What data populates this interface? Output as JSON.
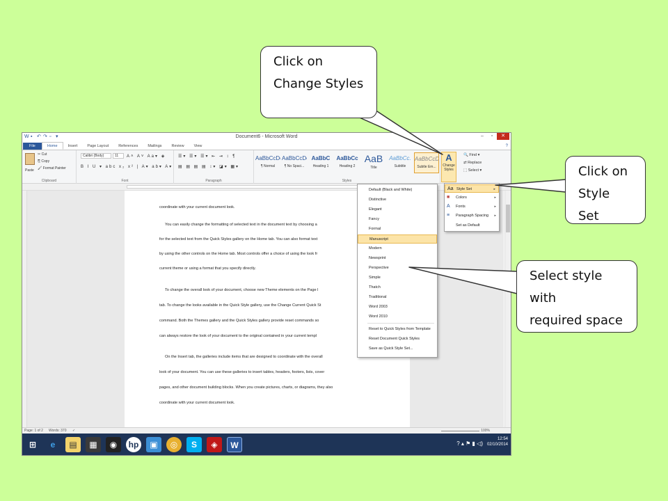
{
  "callouts": {
    "change_styles": [
      "Click on",
      "Change Styles"
    ],
    "style_set": [
      "Click on",
      "Style Set"
    ],
    "select_style": [
      "Select style with",
      "required space"
    ]
  },
  "window": {
    "title": "Document6 - Microsoft Word"
  },
  "tabs": [
    "File",
    "Home",
    "Insert",
    "Page Layout",
    "References",
    "Mailings",
    "Review",
    "View"
  ],
  "clipboard": {
    "paste": "Paste",
    "cut": "Cut",
    "copy": "Copy",
    "format_painter": "Format Painter",
    "group": "Clipboard"
  },
  "font": {
    "name": "Calibri (Body)",
    "size": "11",
    "group": "Font"
  },
  "paragraph": {
    "group": "Paragraph"
  },
  "styles": {
    "items": [
      {
        "preview": "AaBbCcDc",
        "name": "¶ Normal"
      },
      {
        "preview": "AaBbCcDc",
        "name": "¶ No Spaci..."
      },
      {
        "preview": "AaBbC",
        "name": "Heading 1"
      },
      {
        "preview": "AaBbCc",
        "name": "Heading 2"
      },
      {
        "preview": "AaB",
        "name": "Title"
      },
      {
        "preview": "AaBbCc.",
        "name": "Subtitle"
      },
      {
        "preview": "AaBbCcDc",
        "name": "Subtle Em..."
      }
    ],
    "group": "Styles",
    "change_styles": "Change Styles"
  },
  "editing": {
    "find": "Find",
    "replace": "Replace",
    "select": "Select"
  },
  "style_set_menu": {
    "items": [
      "Default (Black and White)",
      "Distinctive",
      "Elegant",
      "Fancy",
      "Formal",
      "Manuscript",
      "Modern",
      "Newsprint",
      "Perspective",
      "Simple",
      "Thatch",
      "Traditional",
      "Word 2003",
      "Word 2010"
    ],
    "highlighted": "Manuscript",
    "actions": [
      "Reset to Quick Styles from Template",
      "Reset Document Quick Styles",
      "Save as Quick Style Set..."
    ]
  },
  "change_styles_menu": {
    "items": [
      "Style Set",
      "Colors",
      "Fonts",
      "Paragraph Spacing",
      "Set as Default"
    ],
    "highlighted": "Style Set"
  },
  "document": {
    "lines": [
      "coordinate with your current document look.",
      "You can easily change the formatting of selected text in the document text by choosing a",
      "for the selected text from the Quick Styles gallery on the Home tab. You can also format text",
      "by using the other controls on the Home tab. Most controls offer a choice of using the look fr",
      "current theme or using a format that you specify directly.",
      "To change the overall look of your document, choose new Theme elements on the Page l",
      "tab. To change the looks available in the Quick Style gallery, use the Change Current Quick St",
      "command. Both the Themes gallery and the Quick Styles gallery provide reset commands so",
      "can always restore the look of your document to the original contained in your current templ",
      "On the Insert tab, the galleries include items that are designed to coordinate with the overall",
      "look of your document. You can use these galleries to insert tables, headers, footers, lists, cover",
      "pages, and other document building blocks. When you create pictures, charts, or diagrams, they also",
      "coordinate with your current document look."
    ]
  },
  "status": {
    "page": "Page: 1 of 2",
    "words": "Words: 370",
    "zoom": "100%"
  },
  "tray": {
    "time": "12:54",
    "date": "02/10/2014"
  },
  "colors": {
    "background": "#ccff99",
    "word_blue": "#2b579a",
    "highlight": "#fce4a8",
    "taskbar": "#1e3457"
  }
}
